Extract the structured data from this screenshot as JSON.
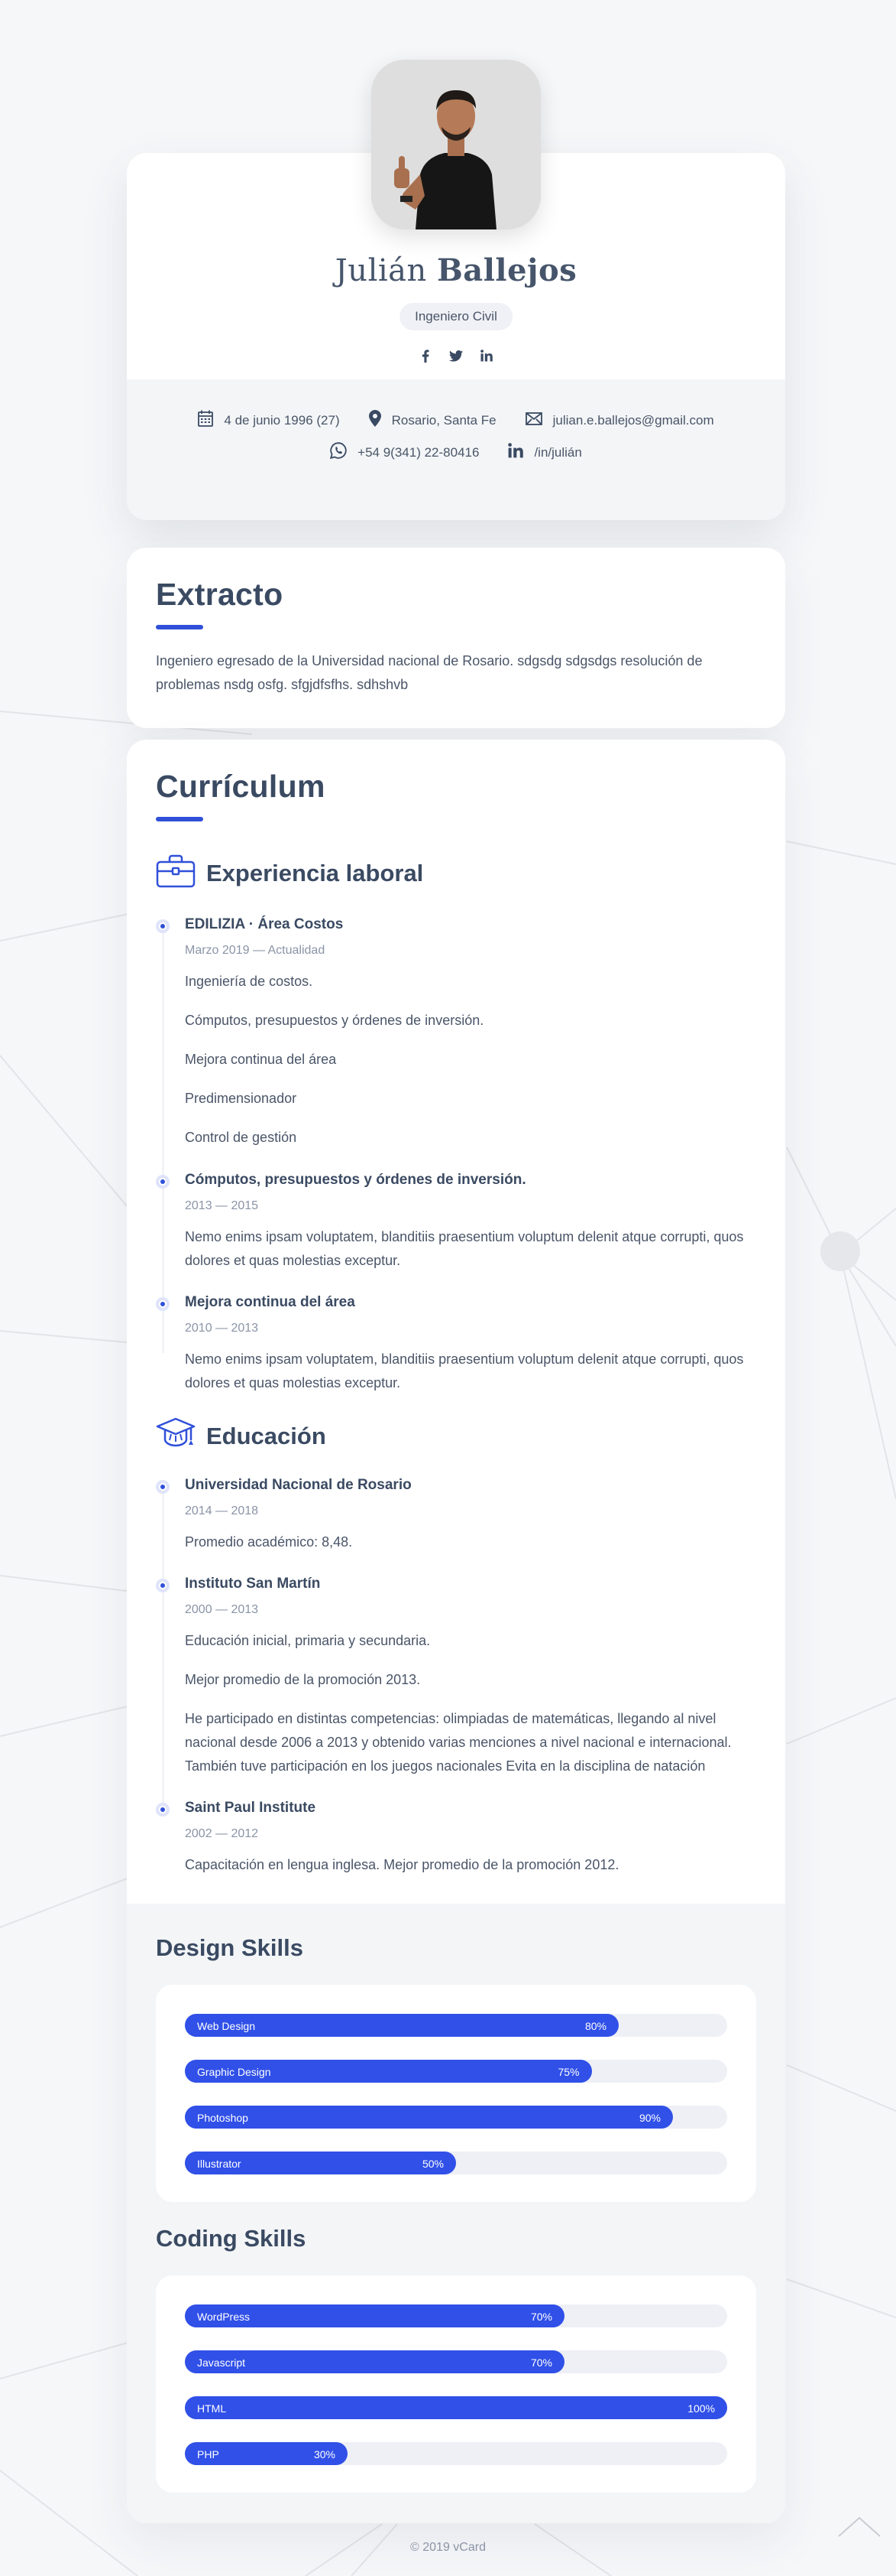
{
  "profile": {
    "first_name": "Julián",
    "last_name": "Ballejos",
    "role": "Ingeniero Civil",
    "socials": [
      "facebook-icon",
      "twitter-icon",
      "linkedin-icon"
    ],
    "contacts": {
      "birthday": "4 de junio 1996 (27)",
      "location": "Rosario, Santa Fe",
      "email": "julian.e.ballejos@gmail.com",
      "phone": "+54 9(341) 22-80416",
      "linkedin": "/in/julián"
    }
  },
  "summary": {
    "title": "Extracto",
    "text": "Ingeniero egresado de la Universidad nacional de Rosario. sdgsdg sdgsdgs resolución de problemas nsdg osfg. sfgjdfsfhs. sdhshvb"
  },
  "curriculum": {
    "title": "Currículum",
    "experience": {
      "heading": "Experiencia laboral",
      "items": [
        {
          "title": "EDILIZIA · Área Costos",
          "period": "Marzo 2019 — Actualidad",
          "lines": [
            "Ingeniería de costos.",
            "Cómputos, presupuestos y órdenes de inversión.",
            "Mejora continua del área",
            "Predimensionador",
            "Control de gestión"
          ]
        },
        {
          "title": "Cómputos, presupuestos y órdenes de inversión.",
          "period": "2013 — 2015",
          "lines": [
            "Nemo enims ipsam voluptatem, blanditiis praesentium voluptum delenit atque corrupti, quos dolores et quas molestias exceptur."
          ]
        },
        {
          "title": "Mejora continua del área",
          "period": "2010 — 2013",
          "lines": [
            "Nemo enims ipsam voluptatem, blanditiis praesentium voluptum delenit atque corrupti, quos dolores et quas molestias exceptur."
          ]
        }
      ]
    },
    "education": {
      "heading": "Educación",
      "items": [
        {
          "title": "Universidad Nacional de Rosario",
          "period": "2014 — 2018",
          "lines": [
            "Promedio académico: 8,48."
          ]
        },
        {
          "title": "Instituto San Martín",
          "period": "2000 — 2013",
          "lines": [
            "Educación inicial, primaria y secundaria.",
            "Mejor promedio de la promoción 2013.",
            "He participado en distintas competencias: olimpiadas de matemáticas, llegando al nivel nacional desde 2006 a 2013 y obtenido varias menciones a nivel nacional e internacional. También tuve participación en los juegos nacionales Evita en la disciplina de natación"
          ]
        },
        {
          "title": "Saint Paul Institute",
          "period": "2002 — 2012",
          "lines": [
            "Capacitación en lengua inglesa. Mejor promedio de la promoción 2012."
          ]
        }
      ]
    }
  },
  "design_skills": {
    "title": "Design Skills",
    "items": [
      {
        "name": "Web Design",
        "value": 80,
        "label": "80%"
      },
      {
        "name": "Graphic Design",
        "value": 75,
        "label": "75%"
      },
      {
        "name": "Photoshop",
        "value": 90,
        "label": "90%"
      },
      {
        "name": "Illustrator",
        "value": 50,
        "label": "50%"
      }
    ]
  },
  "coding_skills": {
    "title": "Coding Skills",
    "items": [
      {
        "name": "WordPress",
        "value": 70,
        "label": "70%"
      },
      {
        "name": "Javascript",
        "value": 70,
        "label": "70%"
      },
      {
        "name": "HTML",
        "value": 100,
        "label": "100%"
      },
      {
        "name": "PHP",
        "value": 30,
        "label": "30%"
      }
    ]
  },
  "footer": "© 2019 vCard",
  "colors": {
    "accent": "#3050e8",
    "text": "#3d4a5c",
    "muted": "#8a94a6",
    "background": "#f6f7f9"
  }
}
